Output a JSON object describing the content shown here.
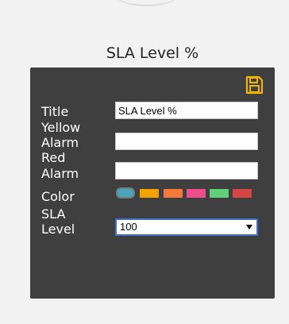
{
  "widget": {
    "title": "SLA Level %"
  },
  "form": {
    "title_label": "Title",
    "title_value": "SLA Level %",
    "yellow_label_line1": "Yellow",
    "yellow_label_line2": "Alarm",
    "yellow_value": "",
    "red_label_line1": "Red",
    "red_label_line2": "Alarm",
    "red_value": "",
    "color_label": "Color",
    "colors": [
      "#4aa6b6",
      "#f5a300",
      "#f4793b",
      "#ee4e8c",
      "#5fd17a",
      "#d74444"
    ],
    "selected_color_index": 0,
    "sla_label_line1": "SLA",
    "sla_label_line2": "Level",
    "sla_level_value": "100"
  },
  "icons": {
    "save": "floppy-disk-icon",
    "save_color": "#f5b400",
    "dropdown": "chevron-down-icon"
  }
}
